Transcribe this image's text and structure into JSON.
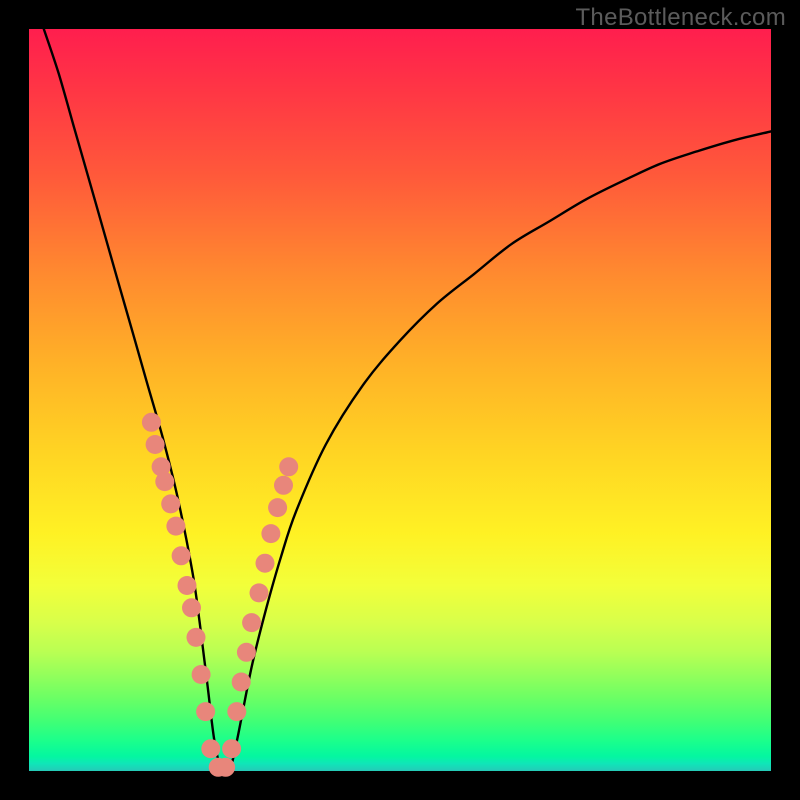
{
  "watermark": "TheBottleneck.com",
  "chart_data": {
    "type": "line",
    "title": "",
    "xlabel": "",
    "ylabel": "",
    "xlim": [
      0,
      100
    ],
    "ylim": [
      0,
      100
    ],
    "series": [
      {
        "name": "bottleneck-curve",
        "x": [
          2,
          4,
          6,
          8,
          10,
          12,
          14,
          16,
          18,
          20,
          22,
          23,
          24,
          25,
          26,
          27,
          28,
          30,
          32,
          34,
          36,
          40,
          45,
          50,
          55,
          60,
          65,
          70,
          75,
          80,
          85,
          90,
          95,
          100
        ],
        "values": [
          100,
          94,
          87,
          80,
          73,
          66,
          59,
          52,
          45,
          37,
          27,
          20,
          12,
          4,
          0,
          0,
          4,
          14,
          22,
          29,
          35,
          44,
          52,
          58,
          63,
          67,
          71,
          74,
          77,
          79.5,
          81.8,
          83.5,
          85,
          86.2
        ]
      }
    ],
    "markers": {
      "name": "highlight-dots",
      "color": "#e8867b",
      "points": [
        {
          "x": 16.5,
          "y": 47
        },
        {
          "x": 17.0,
          "y": 44
        },
        {
          "x": 17.8,
          "y": 41
        },
        {
          "x": 18.3,
          "y": 39
        },
        {
          "x": 19.1,
          "y": 36
        },
        {
          "x": 19.8,
          "y": 33
        },
        {
          "x": 20.5,
          "y": 29
        },
        {
          "x": 21.3,
          "y": 25
        },
        {
          "x": 21.9,
          "y": 22
        },
        {
          "x": 22.5,
          "y": 18
        },
        {
          "x": 23.2,
          "y": 13
        },
        {
          "x": 23.8,
          "y": 8
        },
        {
          "x": 24.5,
          "y": 3
        },
        {
          "x": 25.5,
          "y": 0.5
        },
        {
          "x": 26.5,
          "y": 0.5
        },
        {
          "x": 27.3,
          "y": 3
        },
        {
          "x": 28.0,
          "y": 8
        },
        {
          "x": 28.6,
          "y": 12
        },
        {
          "x": 29.3,
          "y": 16
        },
        {
          "x": 30.0,
          "y": 20
        },
        {
          "x": 31.0,
          "y": 24
        },
        {
          "x": 31.8,
          "y": 28
        },
        {
          "x": 32.6,
          "y": 32
        },
        {
          "x": 33.5,
          "y": 35.5
        },
        {
          "x": 34.3,
          "y": 38.5
        },
        {
          "x": 35.0,
          "y": 41
        }
      ]
    }
  }
}
